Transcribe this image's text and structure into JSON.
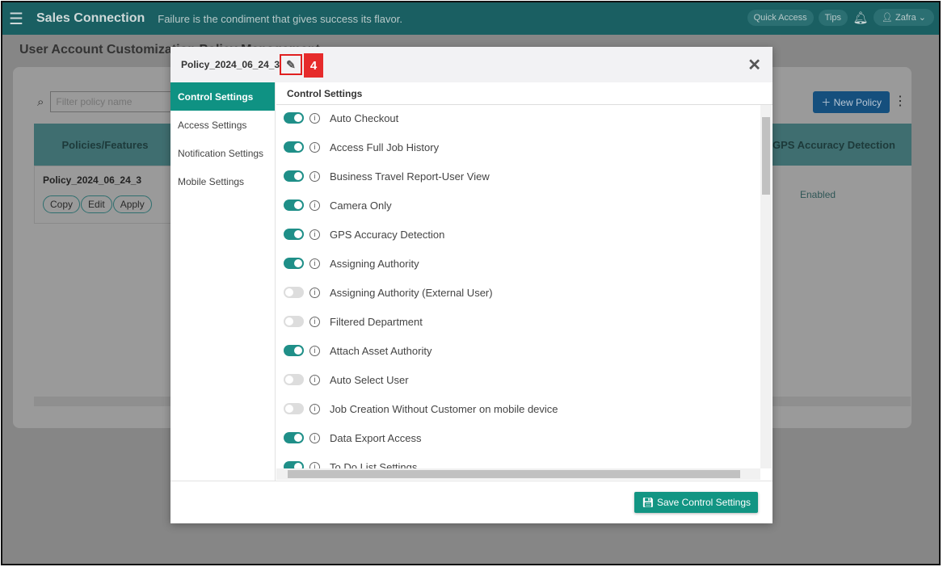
{
  "header": {
    "app_name": "Sales Connection",
    "slogan": "Failure is the condiment that gives success its flavor.",
    "quick_access": "Quick Access",
    "tips": "Tips",
    "user": "Zafra"
  },
  "page": {
    "title": "User Account Customization Policy Management",
    "filter_placeholder": "Filter policy name",
    "new_policy": "New Policy",
    "col_policies": "Policies/Features",
    "col_gps": "GPS Accuracy Detection",
    "row_name": "Policy_2024_06_24_3",
    "copy": "Copy",
    "edit": "Edit",
    "apply": "Apply",
    "gps_value": "Enabled"
  },
  "modal": {
    "title": "Policy_2024_06_24_3",
    "annotation": "4",
    "nav": [
      "Control Settings",
      "Access Settings",
      "Notification Settings",
      "Mobile Settings"
    ],
    "section_title": "Control Settings",
    "items": [
      {
        "label": "Auto Checkout",
        "on": true
      },
      {
        "label": "Access Full Job History",
        "on": true
      },
      {
        "label": "Business Travel Report-User View",
        "on": true
      },
      {
        "label": "Camera Only",
        "on": true
      },
      {
        "label": "GPS Accuracy Detection",
        "on": true
      },
      {
        "label": "Assigning Authority",
        "on": true
      },
      {
        "label": "Assigning Authority (External User)",
        "on": false
      },
      {
        "label": "Filtered Department",
        "on": false
      },
      {
        "label": "Attach Asset Authority",
        "on": true
      },
      {
        "label": "Auto Select User",
        "on": false
      },
      {
        "label": "Job Creation Without Customer on mobile device",
        "on": false
      },
      {
        "label": "Data Export Access",
        "on": true
      },
      {
        "label": "To Do List Settings",
        "on": true
      }
    ],
    "save": "Save Control Settings"
  },
  "colors": {
    "accent": "#0f9283",
    "header": "#1a5f62",
    "annotation": "#e62b2b"
  }
}
